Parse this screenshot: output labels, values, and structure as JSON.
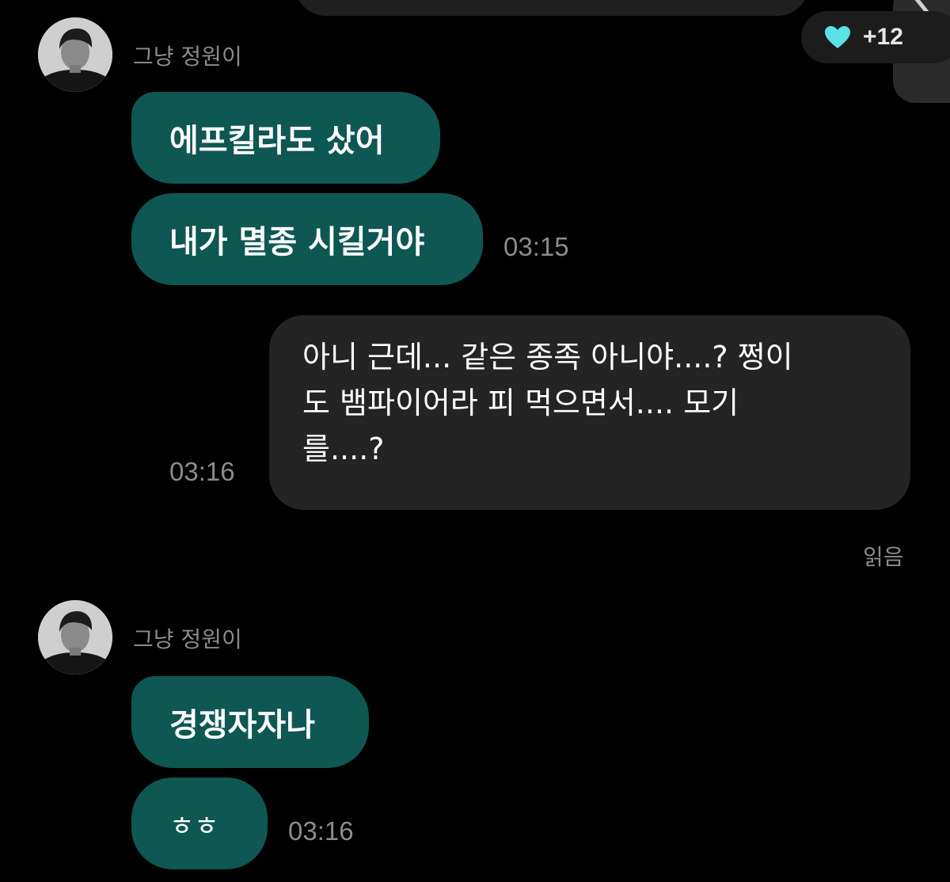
{
  "reaction": {
    "icon": "heart-icon",
    "count": "+12",
    "heart_color": "#5ce1e6"
  },
  "colors": {
    "incoming_bubble": "#0e5752",
    "outgoing_bubble": "#242424",
    "background": "#000000",
    "meta_text": "#8c8c8c"
  },
  "groups": [
    {
      "sender": "그냥 정원이",
      "messages": [
        "에프킬라도 샀어",
        "내가 멸종 시킬거야"
      ],
      "time": "03:15"
    },
    {
      "sender": "그냥 정원이",
      "messages": [
        "경쟁자자나",
        "ㅎㅎ"
      ],
      "time": "03:16"
    }
  ],
  "outgoing": {
    "lines": [
      "아니 근데... 같은 종족 아니야....? 쩡이",
      "도 뱀파이어라 피 먹으면서.... 모기",
      "를....?"
    ],
    "time": "03:16",
    "status": "읽음"
  }
}
